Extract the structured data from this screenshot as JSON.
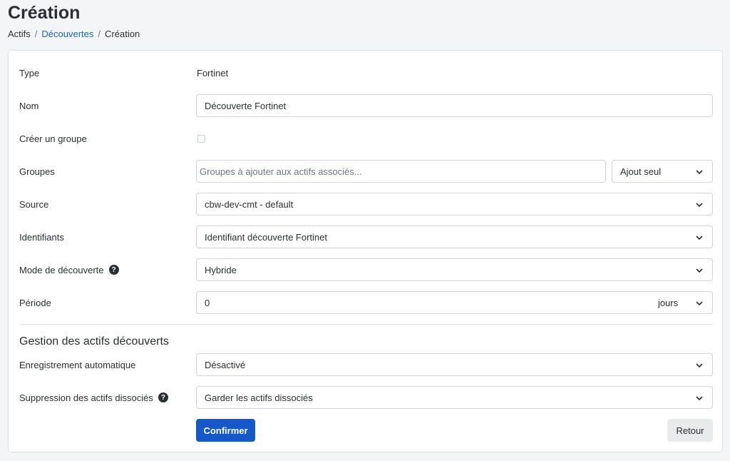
{
  "page": {
    "title": "Création"
  },
  "breadcrumb": {
    "root": "Actifs",
    "link": "Découvertes",
    "current": "Création",
    "separator": "/"
  },
  "form": {
    "type": {
      "label": "Type",
      "value": "Fortinet"
    },
    "name": {
      "label": "Nom",
      "value": "Découverte Fortinet"
    },
    "create_group": {
      "label": "Créer un groupe",
      "checked": false
    },
    "groups": {
      "label": "Groupes",
      "placeholder": "Groupes à ajouter aux actifs associés...",
      "mode": "Ajout seul"
    },
    "source": {
      "label": "Source",
      "value": "cbw-dev-cmt - default"
    },
    "credentials": {
      "label": "Identifiants",
      "value": "Identifiant découverte Fortinet"
    },
    "discovery_mode": {
      "label": "Mode de découverte",
      "value": "Hybride",
      "help": "?"
    },
    "period": {
      "label": "Période",
      "value": "0",
      "unit": "jours"
    }
  },
  "section": {
    "title": "Gestion des actifs découverts",
    "auto_register": {
      "label": "Enregistrement automatique",
      "value": "Désactivé"
    },
    "delete_dissociated": {
      "label": "Suppression des actifs dissociés",
      "value": "Garder les actifs dissociés",
      "help": "?"
    }
  },
  "actions": {
    "confirm": "Confirmer",
    "back": "Retour"
  },
  "colors": {
    "primary": "#1558c9",
    "link": "#1c62c8",
    "border": "#ced4da"
  }
}
